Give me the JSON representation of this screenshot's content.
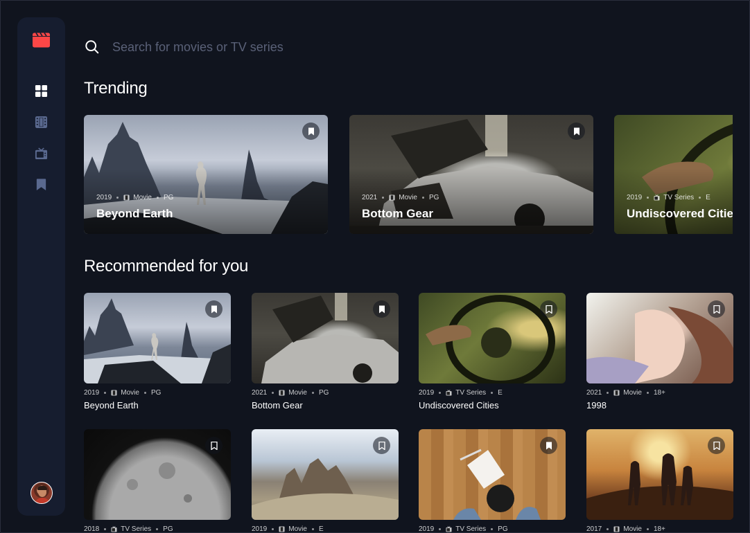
{
  "app": {
    "accent_color": "#fc4747",
    "background": "#10141e",
    "sidebar_color": "#161d2f"
  },
  "sidebar": {
    "logo_icon": "film-clapper-icon",
    "items": [
      {
        "name": "home",
        "icon": "grid-icon",
        "active": true
      },
      {
        "name": "movies",
        "icon": "film-icon",
        "active": false
      },
      {
        "name": "tv-series",
        "icon": "tv-icon",
        "active": false
      },
      {
        "name": "bookmarks",
        "icon": "bookmark-icon",
        "active": false
      }
    ],
    "avatar_icon": "user-avatar"
  },
  "search": {
    "placeholder": "Search for movies or TV series",
    "value": ""
  },
  "trending": {
    "title": "Trending",
    "items": [
      {
        "year": "2019",
        "category": "Movie",
        "category_icon": "film-icon",
        "rating": "PG",
        "title": "Beyond Earth",
        "bookmarked": true
      },
      {
        "year": "2021",
        "category": "Movie",
        "category_icon": "film-icon",
        "rating": "PG",
        "title": "Bottom Gear",
        "bookmarked": true
      },
      {
        "year": "2019",
        "category": "TV Series",
        "category_icon": "tv-icon",
        "rating": "E",
        "title": "Undiscovered Cities",
        "bookmarked": false
      }
    ]
  },
  "recommended": {
    "title": "Recommended for you",
    "items": [
      {
        "year": "2019",
        "category": "Movie",
        "category_icon": "film-icon",
        "rating": "PG",
        "title": "Beyond Earth",
        "bookmarked": true
      },
      {
        "year": "2021",
        "category": "Movie",
        "category_icon": "film-icon",
        "rating": "PG",
        "title": "Bottom Gear",
        "bookmarked": true
      },
      {
        "year": "2019",
        "category": "TV Series",
        "category_icon": "tv-icon",
        "rating": "E",
        "title": "Undiscovered Cities",
        "bookmarked": false
      },
      {
        "year": "2021",
        "category": "Movie",
        "category_icon": "film-icon",
        "rating": "18+",
        "title": "1998",
        "bookmarked": false
      },
      {
        "year": "2018",
        "category": "TV Series",
        "category_icon": "tv-icon",
        "rating": "PG",
        "title": "",
        "bookmarked": false
      },
      {
        "year": "2019",
        "category": "Movie",
        "category_icon": "film-icon",
        "rating": "E",
        "title": "",
        "bookmarked": false
      },
      {
        "year": "2019",
        "category": "TV Series",
        "category_icon": "tv-icon",
        "rating": "PG",
        "title": "",
        "bookmarked": true
      },
      {
        "year": "2017",
        "category": "Movie",
        "category_icon": "film-icon",
        "rating": "18+",
        "title": "",
        "bookmarked": false
      }
    ]
  }
}
